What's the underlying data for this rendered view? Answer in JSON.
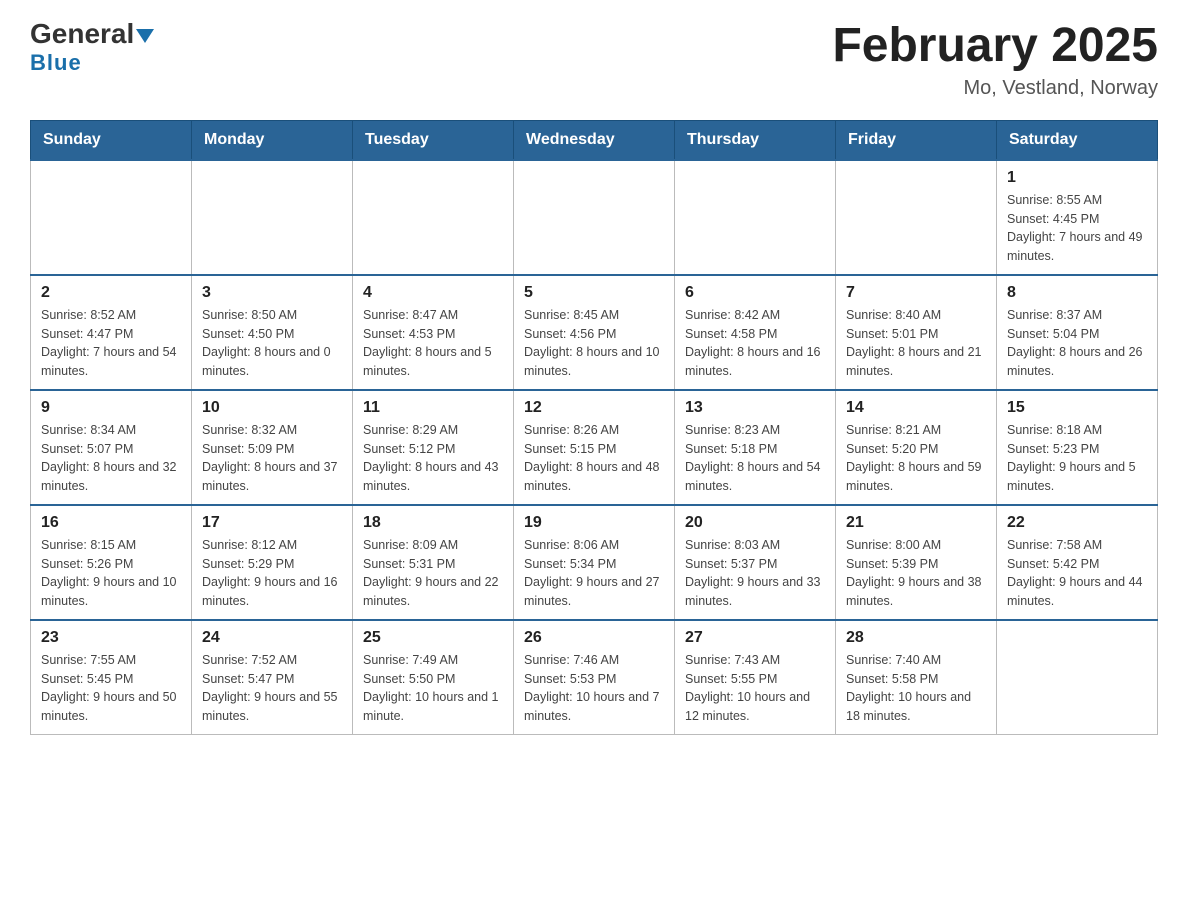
{
  "header": {
    "logo_general": "General",
    "logo_blue": "Blue",
    "title": "February 2025",
    "location": "Mo, Vestland, Norway"
  },
  "days_of_week": [
    "Sunday",
    "Monday",
    "Tuesday",
    "Wednesday",
    "Thursday",
    "Friday",
    "Saturday"
  ],
  "weeks": [
    [
      {
        "day": "",
        "info": ""
      },
      {
        "day": "",
        "info": ""
      },
      {
        "day": "",
        "info": ""
      },
      {
        "day": "",
        "info": ""
      },
      {
        "day": "",
        "info": ""
      },
      {
        "day": "",
        "info": ""
      },
      {
        "day": "1",
        "info": "Sunrise: 8:55 AM\nSunset: 4:45 PM\nDaylight: 7 hours and 49 minutes."
      }
    ],
    [
      {
        "day": "2",
        "info": "Sunrise: 8:52 AM\nSunset: 4:47 PM\nDaylight: 7 hours and 54 minutes."
      },
      {
        "day": "3",
        "info": "Sunrise: 8:50 AM\nSunset: 4:50 PM\nDaylight: 8 hours and 0 minutes."
      },
      {
        "day": "4",
        "info": "Sunrise: 8:47 AM\nSunset: 4:53 PM\nDaylight: 8 hours and 5 minutes."
      },
      {
        "day": "5",
        "info": "Sunrise: 8:45 AM\nSunset: 4:56 PM\nDaylight: 8 hours and 10 minutes."
      },
      {
        "day": "6",
        "info": "Sunrise: 8:42 AM\nSunset: 4:58 PM\nDaylight: 8 hours and 16 minutes."
      },
      {
        "day": "7",
        "info": "Sunrise: 8:40 AM\nSunset: 5:01 PM\nDaylight: 8 hours and 21 minutes."
      },
      {
        "day": "8",
        "info": "Sunrise: 8:37 AM\nSunset: 5:04 PM\nDaylight: 8 hours and 26 minutes."
      }
    ],
    [
      {
        "day": "9",
        "info": "Sunrise: 8:34 AM\nSunset: 5:07 PM\nDaylight: 8 hours and 32 minutes."
      },
      {
        "day": "10",
        "info": "Sunrise: 8:32 AM\nSunset: 5:09 PM\nDaylight: 8 hours and 37 minutes."
      },
      {
        "day": "11",
        "info": "Sunrise: 8:29 AM\nSunset: 5:12 PM\nDaylight: 8 hours and 43 minutes."
      },
      {
        "day": "12",
        "info": "Sunrise: 8:26 AM\nSunset: 5:15 PM\nDaylight: 8 hours and 48 minutes."
      },
      {
        "day": "13",
        "info": "Sunrise: 8:23 AM\nSunset: 5:18 PM\nDaylight: 8 hours and 54 minutes."
      },
      {
        "day": "14",
        "info": "Sunrise: 8:21 AM\nSunset: 5:20 PM\nDaylight: 8 hours and 59 minutes."
      },
      {
        "day": "15",
        "info": "Sunrise: 8:18 AM\nSunset: 5:23 PM\nDaylight: 9 hours and 5 minutes."
      }
    ],
    [
      {
        "day": "16",
        "info": "Sunrise: 8:15 AM\nSunset: 5:26 PM\nDaylight: 9 hours and 10 minutes."
      },
      {
        "day": "17",
        "info": "Sunrise: 8:12 AM\nSunset: 5:29 PM\nDaylight: 9 hours and 16 minutes."
      },
      {
        "day": "18",
        "info": "Sunrise: 8:09 AM\nSunset: 5:31 PM\nDaylight: 9 hours and 22 minutes."
      },
      {
        "day": "19",
        "info": "Sunrise: 8:06 AM\nSunset: 5:34 PM\nDaylight: 9 hours and 27 minutes."
      },
      {
        "day": "20",
        "info": "Sunrise: 8:03 AM\nSunset: 5:37 PM\nDaylight: 9 hours and 33 minutes."
      },
      {
        "day": "21",
        "info": "Sunrise: 8:00 AM\nSunset: 5:39 PM\nDaylight: 9 hours and 38 minutes."
      },
      {
        "day": "22",
        "info": "Sunrise: 7:58 AM\nSunset: 5:42 PM\nDaylight: 9 hours and 44 minutes."
      }
    ],
    [
      {
        "day": "23",
        "info": "Sunrise: 7:55 AM\nSunset: 5:45 PM\nDaylight: 9 hours and 50 minutes."
      },
      {
        "day": "24",
        "info": "Sunrise: 7:52 AM\nSunset: 5:47 PM\nDaylight: 9 hours and 55 minutes."
      },
      {
        "day": "25",
        "info": "Sunrise: 7:49 AM\nSunset: 5:50 PM\nDaylight: 10 hours and 1 minute."
      },
      {
        "day": "26",
        "info": "Sunrise: 7:46 AM\nSunset: 5:53 PM\nDaylight: 10 hours and 7 minutes."
      },
      {
        "day": "27",
        "info": "Sunrise: 7:43 AM\nSunset: 5:55 PM\nDaylight: 10 hours and 12 minutes."
      },
      {
        "day": "28",
        "info": "Sunrise: 7:40 AM\nSunset: 5:58 PM\nDaylight: 10 hours and 18 minutes."
      },
      {
        "day": "",
        "info": ""
      }
    ]
  ]
}
